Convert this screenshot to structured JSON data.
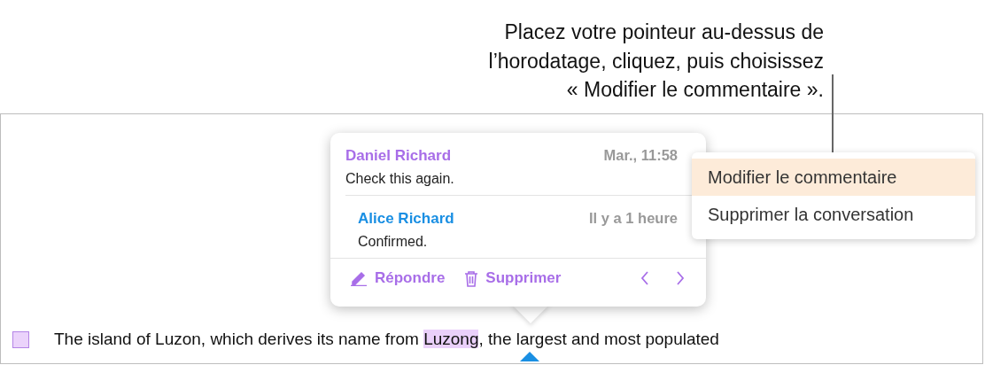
{
  "callout": {
    "lines": [
      "Placez votre pointeur au-dessus de",
      "l’horodatage, cliquez, puis choisissez",
      "« Modifier le commentaire »."
    ]
  },
  "comment_popover": {
    "comments": [
      {
        "author": "Daniel Richard",
        "color": "#a86ee8",
        "time": "Mar., 11:58",
        "text": "Check this again.",
        "kind": "comment"
      },
      {
        "author": "Alice Richard",
        "color": "#1a8fe3",
        "time": "Il y a 1 heure",
        "text": "Confirmed.",
        "kind": "reply"
      }
    ],
    "actions": [
      {
        "label": "Répondre",
        "kind": "reply"
      },
      {
        "label": "Supprimer",
        "kind": "delete"
      }
    ]
  },
  "context_menu": {
    "items": [
      {
        "label": "Modifier le commentaire",
        "selected": true
      },
      {
        "label": "Supprimer la conversation",
        "selected": false
      }
    ]
  },
  "document": {
    "text_before": "The island of Luzon, which derives its name from ",
    "highlight": "Luzong",
    "text_after": ", the largest and most populated"
  }
}
